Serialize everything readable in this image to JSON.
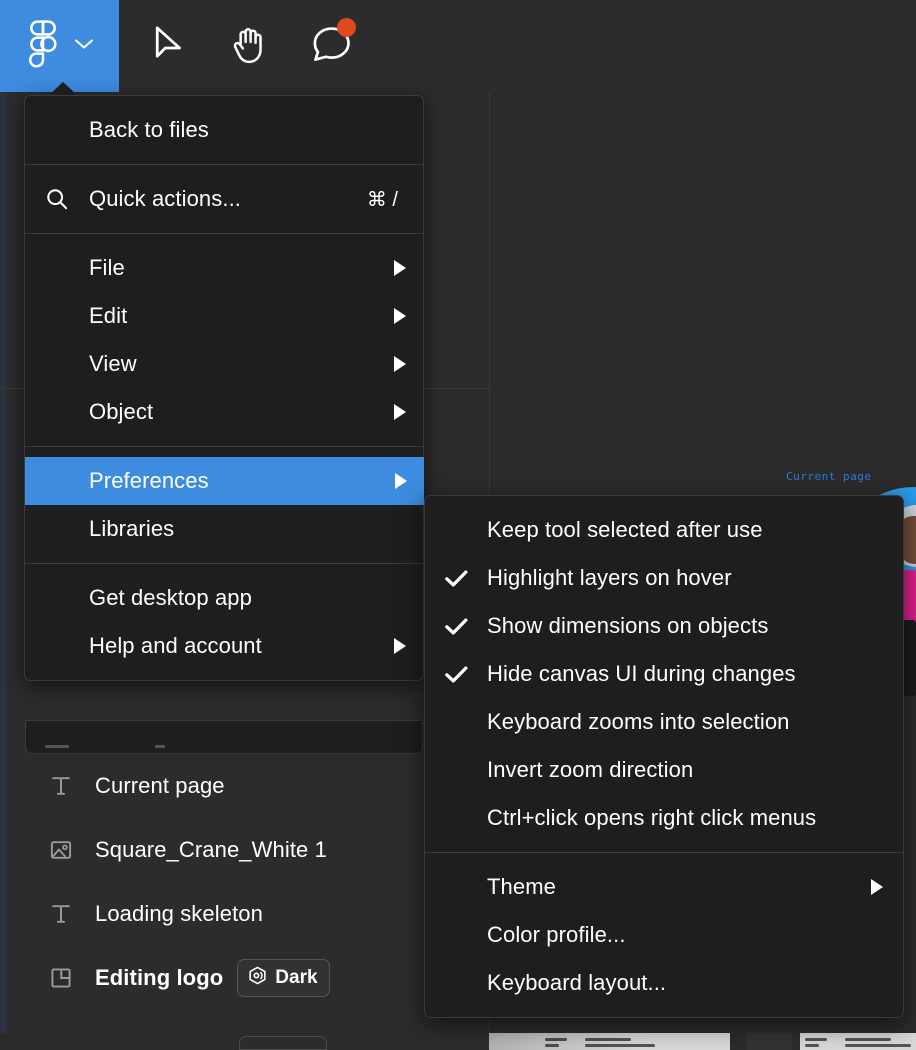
{
  "toolbar": {
    "figma_logo_label": "Figma",
    "menu_chevron": "chevron-down",
    "tools": [
      {
        "name": "move-tool",
        "label": "Move"
      },
      {
        "name": "hand-tool",
        "label": "Hand"
      },
      {
        "name": "comment-tool",
        "label": "Comment",
        "has_badge": true
      }
    ],
    "accent_blue": "#3d8ce0",
    "badge_color": "#e0481e"
  },
  "main_menu": {
    "groups": [
      {
        "items": [
          {
            "label": "Back to files",
            "icon": "",
            "arrow": false,
            "shortcut": ""
          }
        ]
      },
      {
        "items": [
          {
            "label": "Quick actions...",
            "icon": "search-icon",
            "arrow": false,
            "shortcut": "⌘ /"
          }
        ]
      },
      {
        "items": [
          {
            "label": "File",
            "icon": "",
            "arrow": true,
            "shortcut": ""
          },
          {
            "label": "Edit",
            "icon": "",
            "arrow": true,
            "shortcut": ""
          },
          {
            "label": "View",
            "icon": "",
            "arrow": true,
            "shortcut": ""
          },
          {
            "label": "Object",
            "icon": "",
            "arrow": true,
            "shortcut": ""
          }
        ]
      },
      {
        "items": [
          {
            "label": "Preferences",
            "icon": "",
            "arrow": true,
            "shortcut": "",
            "selected": true
          },
          {
            "label": "Libraries",
            "icon": "",
            "arrow": false,
            "shortcut": ""
          }
        ]
      },
      {
        "items": [
          {
            "label": "Get desktop app",
            "icon": "",
            "arrow": false,
            "shortcut": ""
          },
          {
            "label": "Help and account",
            "icon": "",
            "arrow": true,
            "shortcut": ""
          }
        ]
      }
    ]
  },
  "preferences_submenu": {
    "groups": [
      {
        "items": [
          {
            "label": "Keep tool selected after use",
            "checked": false,
            "arrow": false
          },
          {
            "label": "Highlight layers on hover",
            "checked": true,
            "arrow": false
          },
          {
            "label": "Show dimensions on objects",
            "checked": true,
            "arrow": false
          },
          {
            "label": "Hide canvas UI during changes",
            "checked": true,
            "arrow": false
          },
          {
            "label": "Keyboard zooms into selection",
            "checked": false,
            "arrow": false
          },
          {
            "label": "Invert zoom direction",
            "checked": false,
            "arrow": false
          },
          {
            "label": "Ctrl+click opens right click menus",
            "checked": false,
            "arrow": false
          }
        ]
      },
      {
        "items": [
          {
            "label": "Theme",
            "checked": false,
            "arrow": true
          },
          {
            "label": "Color profile...",
            "checked": false,
            "arrow": false
          },
          {
            "label": "Keyboard layout...",
            "checked": false,
            "arrow": false
          }
        ]
      }
    ],
    "check_glyph": "✔"
  },
  "layers_panel": {
    "rows": [
      {
        "icon": "text-layer-icon",
        "name": "Current page",
        "bold": false,
        "badge": null
      },
      {
        "icon": "image-layer-icon",
        "name": "Square_Crane_White 1",
        "bold": false,
        "badge": null
      },
      {
        "icon": "text-layer-icon",
        "name": "Loading skeleton",
        "bold": false,
        "badge": null
      },
      {
        "icon": "frame-layer-icon",
        "name": "Editing logo",
        "bold": true,
        "badge": "Dark"
      }
    ]
  },
  "canvas": {
    "artwork_label": "Current page",
    "artwork_label_color": "#2f7ae0"
  }
}
